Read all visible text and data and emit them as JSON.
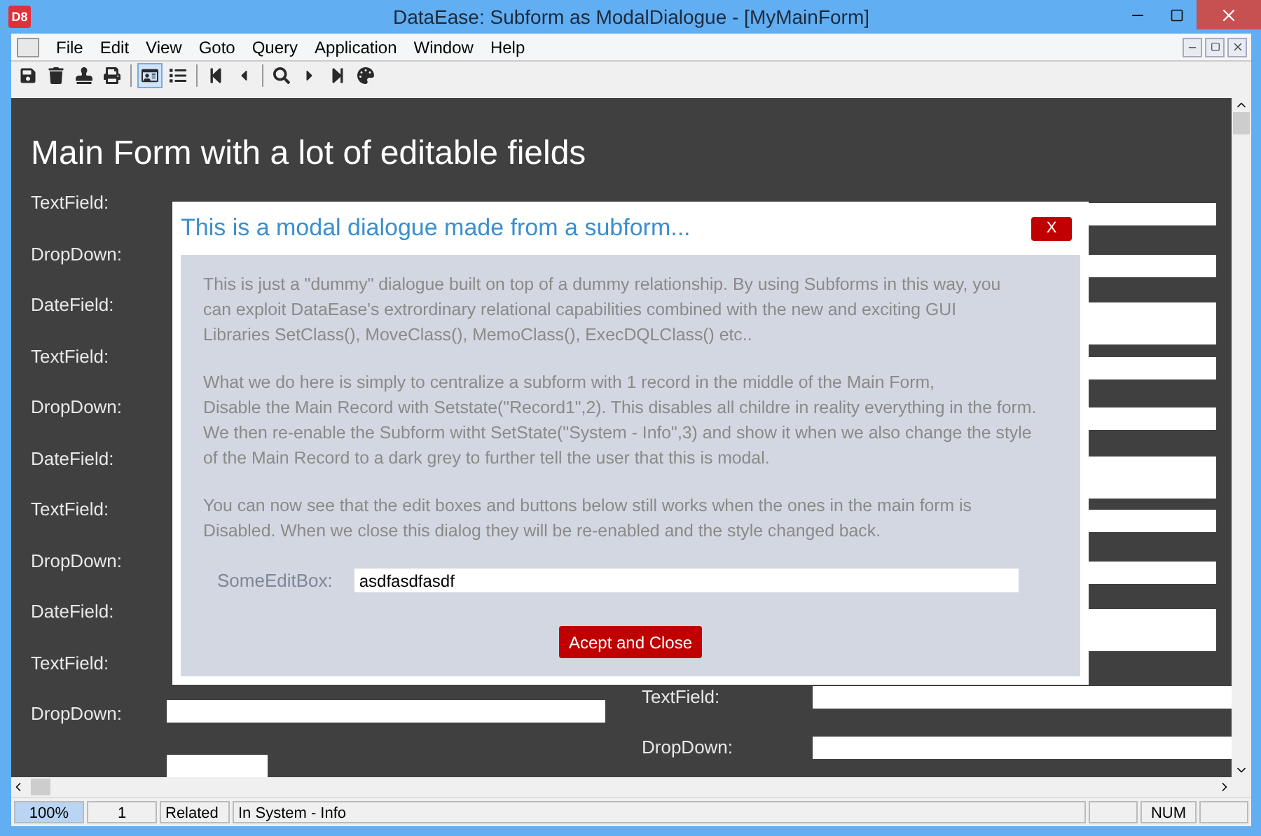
{
  "window": {
    "logo": "D8",
    "title": "DataEase: Subform as ModalDialogue - [MyMainForm]"
  },
  "menu": [
    "File",
    "Edit",
    "View",
    "Goto",
    "Query",
    "Application",
    "Window",
    "Help"
  ],
  "toolbar_buttons": [
    {
      "selected": false
    },
    {
      "selected": false
    },
    {
      "selected": false
    },
    {
      "selected": false
    },
    {
      "selected": true
    },
    {
      "selected": false
    },
    {
      "selected": false
    },
    {
      "selected": false
    },
    {
      "selected": false
    },
    {
      "selected": false
    },
    {
      "selected": false
    },
    {
      "selected": false
    }
  ],
  "main_form": {
    "title": "Main Form with a lot of editable fields",
    "rows": [
      {
        "kind": "text",
        "left_label": "TextField:"
      },
      {
        "kind": "dropdown",
        "left_label": "DropDown:"
      },
      {
        "kind": "date",
        "left_label": "DateField:"
      },
      {
        "kind": "text",
        "left_label": "TextField:"
      },
      {
        "kind": "dropdown",
        "left_label": "DropDown:"
      },
      {
        "kind": "date",
        "left_label": "DateField:"
      },
      {
        "kind": "text",
        "left_label": "TextField:"
      },
      {
        "kind": "dropdown",
        "left_label": "DropDown:"
      },
      {
        "kind": "date",
        "left_label": "DateField:"
      },
      {
        "kind": "text",
        "left_label": "TextField:",
        "right_label": "TextField:"
      },
      {
        "kind": "dropdown",
        "left_label": "DropDown:",
        "right_label": "DropDown:"
      },
      {
        "kind": "date"
      }
    ]
  },
  "dialog": {
    "title": "This is a modal dialogue made from a subform...",
    "close_label": "X",
    "paragraphs": [
      "This is just a \"dummy\" dialogue built on top of a dummy relationship. By using Subforms in this way, you\ncan exploit DataEase's extrordinary relational capabilities combined with the new and exciting GUI\nLibraries  SetClass(), MoveClass(), MemoClass(), ExecDQLClass() etc..",
      "What we do here is simply to centralize a subform with 1 record in the middle of the Main Form,\nDisable the Main Record with Setstate(\"Record1\",2). This disables all childre in reality everything in the form.\nWe then re-enable the Subform witht SetState(\"System - Info\",3) and show it when we also change the style\nof the Main Record to a dark grey to further tell the user that this is modal.",
      "You can now see that the edit boxes and buttons below still works when the ones in the main form is\nDisabled. When we close this dialog they will be re-enabled and the style changed back."
    ],
    "edit_label": "SomeEditBox:",
    "edit_value": "asdfasdfasdf",
    "button": "Acept and Close"
  },
  "status_bar": [
    {
      "text": "100%",
      "selected": true
    },
    {
      "text": "1",
      "selected": false
    },
    {
      "text": "Related",
      "selected": false
    },
    {
      "text": "In System - Info",
      "selected": false
    },
    {
      "text": "NUM",
      "selected": false
    }
  ]
}
